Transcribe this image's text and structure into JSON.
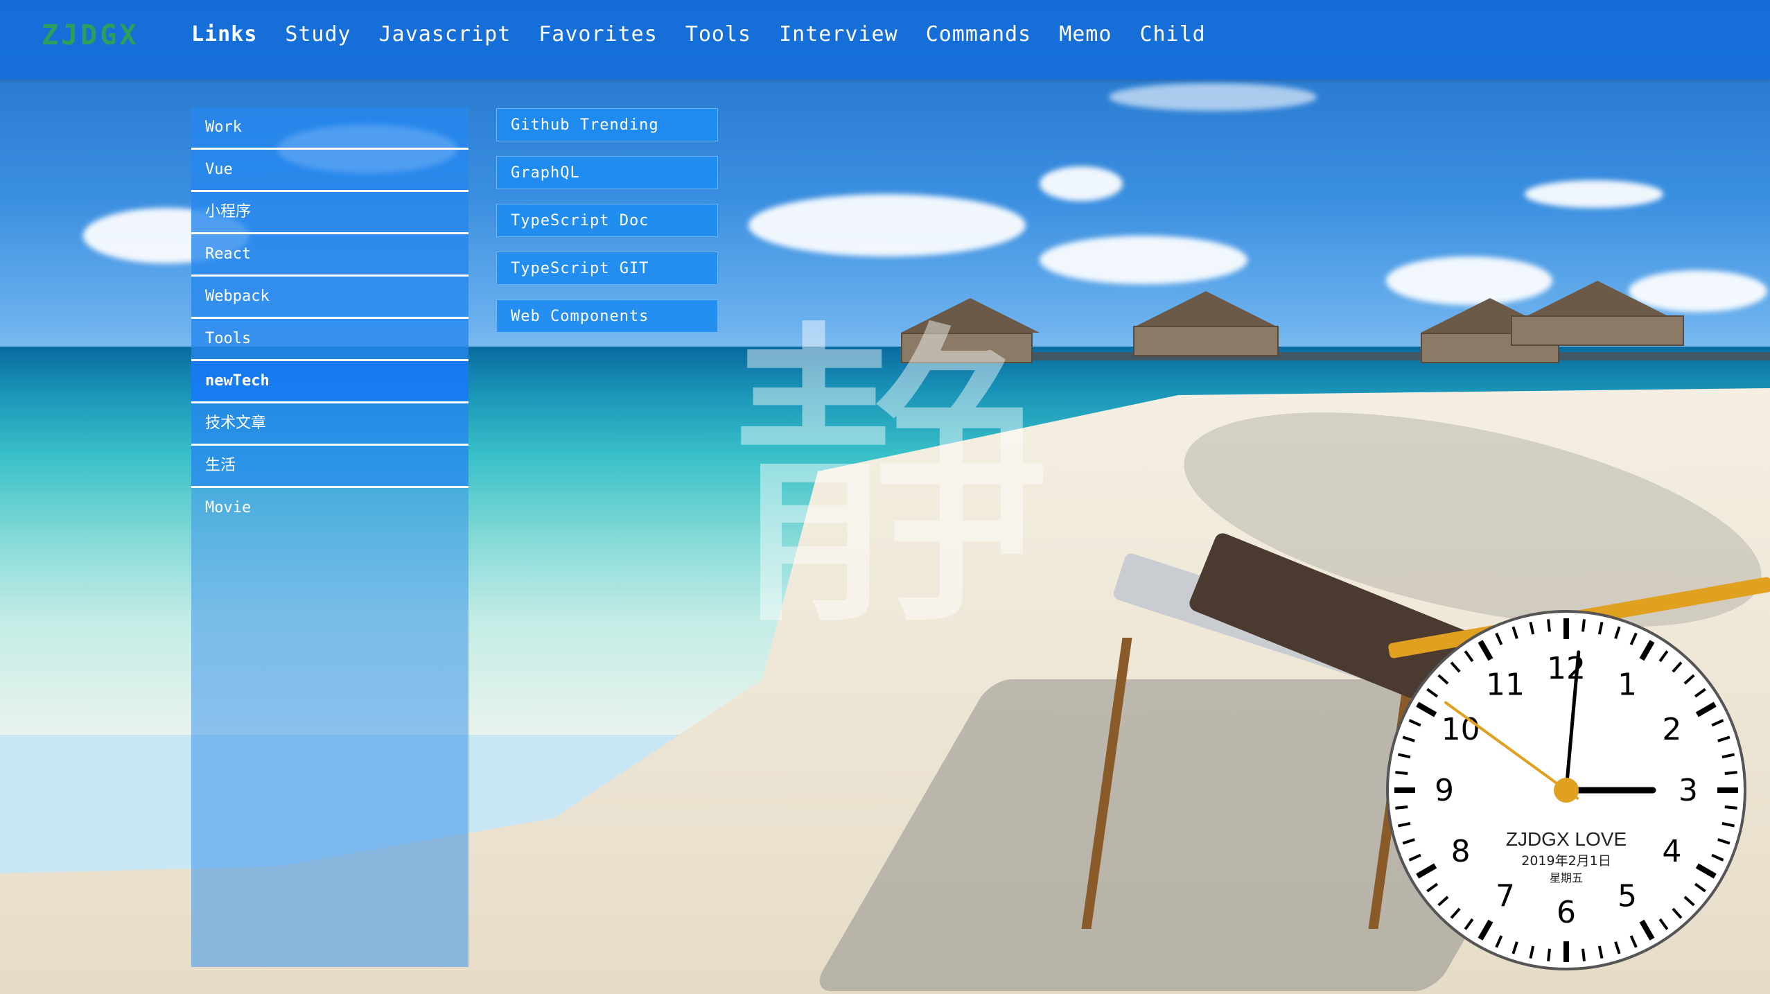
{
  "header": {
    "logo": "ZJDGX",
    "nav": [
      {
        "label": "Links",
        "active": true
      },
      {
        "label": "Study"
      },
      {
        "label": "Javascript"
      },
      {
        "label": "Favorites"
      },
      {
        "label": "Tools"
      },
      {
        "label": "Interview"
      },
      {
        "label": "Commands"
      },
      {
        "label": "Memo"
      },
      {
        "label": "Child"
      }
    ]
  },
  "sidebar": {
    "items": [
      {
        "label": "Work"
      },
      {
        "label": "Vue"
      },
      {
        "label": "小程序"
      },
      {
        "label": "React"
      },
      {
        "label": "Webpack"
      },
      {
        "label": "Tools"
      },
      {
        "label": "newTech",
        "active": true
      },
      {
        "label": "技术文章"
      },
      {
        "label": "生活"
      },
      {
        "label": "Movie"
      }
    ]
  },
  "links": [
    {
      "label": "Github Trending"
    },
    {
      "label": "GraphQL"
    },
    {
      "label": "TypeScript Doc"
    },
    {
      "label": "TypeScript GIT"
    },
    {
      "label": "Web Components"
    }
  ],
  "background": {
    "big_char": "静"
  },
  "clock": {
    "brand": "ZJDGX LOVE",
    "date": "2019年2月1日",
    "weekday": "星期五",
    "numbers": [
      "12",
      "1",
      "2",
      "3",
      "4",
      "5",
      "6",
      "7",
      "8",
      "9",
      "10",
      "11"
    ],
    "time": {
      "hour": 3,
      "minute": 0,
      "second": 51
    },
    "colors": {
      "face": "#ffffff",
      "ink": "#000000",
      "second_hand": "#e0a020"
    }
  },
  "colors": {
    "header": "#146edc",
    "accent": "#1e8cf0",
    "logo": "#2ca05a"
  }
}
